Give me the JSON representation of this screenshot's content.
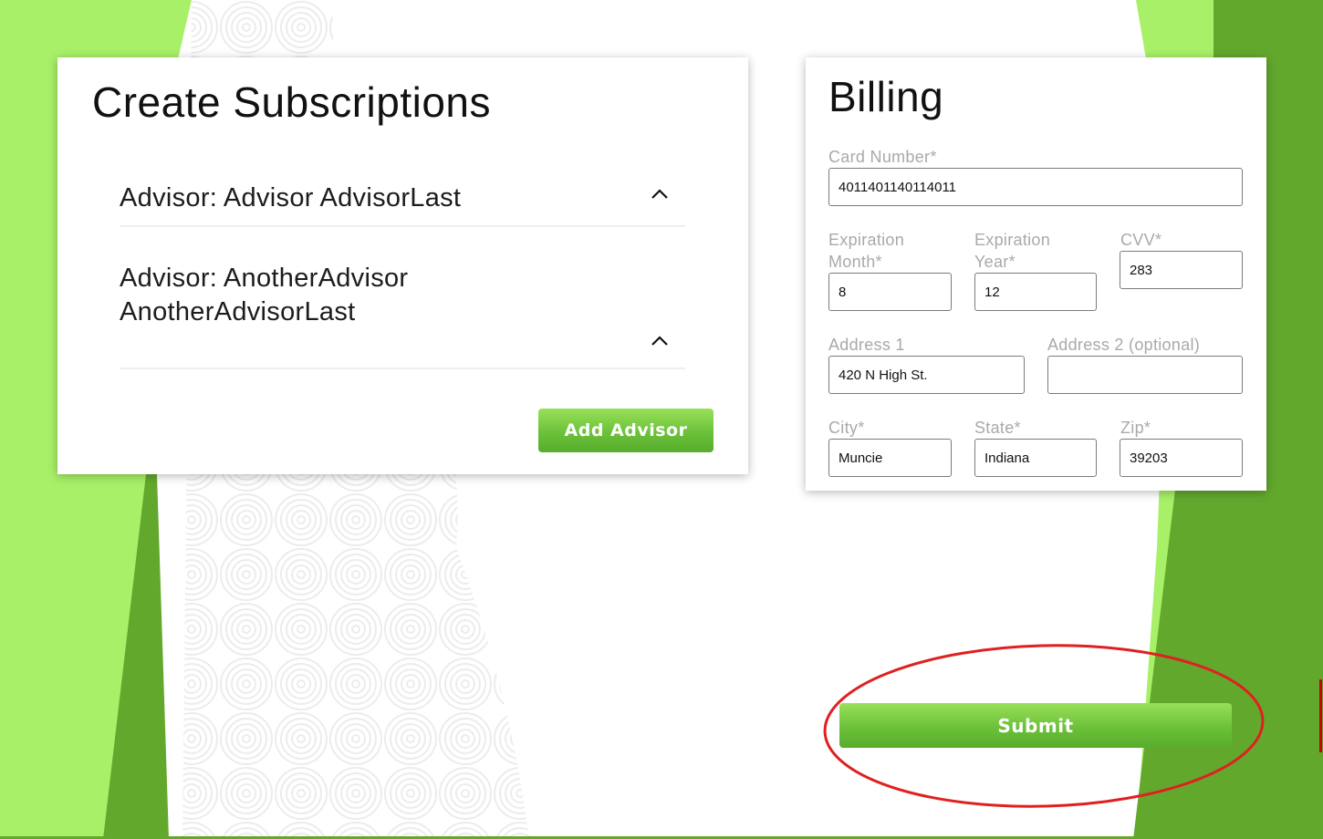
{
  "subscriptions": {
    "title": "Create Subscriptions",
    "advisors": [
      {
        "label": "Advisor: Advisor AdvisorLast"
      },
      {
        "label": "Advisor: AnotherAdvisor AnotherAdvisorLast"
      }
    ],
    "add_button_label": "Add Advisor"
  },
  "billing": {
    "title": "Billing",
    "card_number": {
      "label": "Card Number*",
      "value": "4011401140114011"
    },
    "exp_month": {
      "label": "Expiration Month*",
      "value": "8"
    },
    "exp_year": {
      "label": "Expiration Year*",
      "value": "12"
    },
    "cvv": {
      "label": "CVV*",
      "value": "283"
    },
    "address1": {
      "label": "Address 1",
      "value": "420 N High St."
    },
    "address2": {
      "label": "Address 2 (optional)",
      "value": ""
    },
    "city": {
      "label": "City*",
      "value": "Muncie"
    },
    "state": {
      "label": "State*",
      "value": "Indiana"
    },
    "zip": {
      "label": "Zip*",
      "value": "39203"
    }
  },
  "submit_label": "Submit",
  "colors": {
    "light_green": "#a8f068",
    "dark_green": "#62a82d",
    "button_green": "#6cc13a",
    "annotation_red": "#e02020"
  },
  "icons": {
    "expand": "chevron-up-icon"
  }
}
